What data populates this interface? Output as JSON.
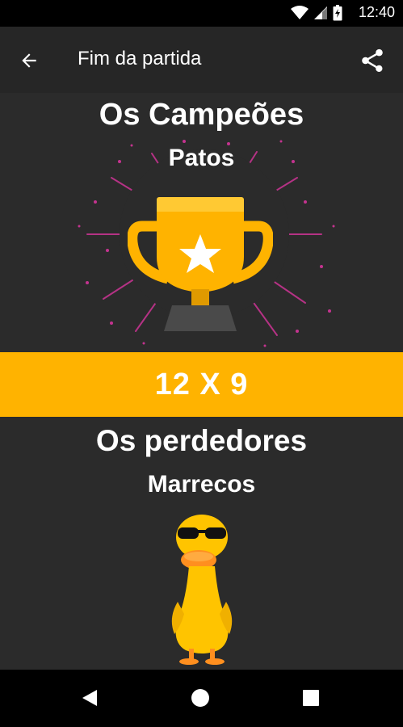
{
  "status_bar": {
    "time": "12:40",
    "icons": [
      "wifi-icon",
      "signal-icon",
      "battery-icon"
    ]
  },
  "app_bar": {
    "title": "Fim da partida",
    "back_icon": "arrow-left-icon",
    "share_icon": "share-icon"
  },
  "result": {
    "winners_heading": "Os Campeões",
    "winners_team": "Patos",
    "score": "12 X 9",
    "losers_heading": "Os perdedores",
    "losers_team": "Marrecos"
  },
  "colors": {
    "accent": "#ffb300",
    "background": "#2b2b2b",
    "app_bar": "#262626",
    "fireworks": "#c4338f"
  },
  "nav_bar": {
    "icons": [
      "back-triangle-icon",
      "home-circle-icon",
      "recents-square-icon"
    ]
  }
}
